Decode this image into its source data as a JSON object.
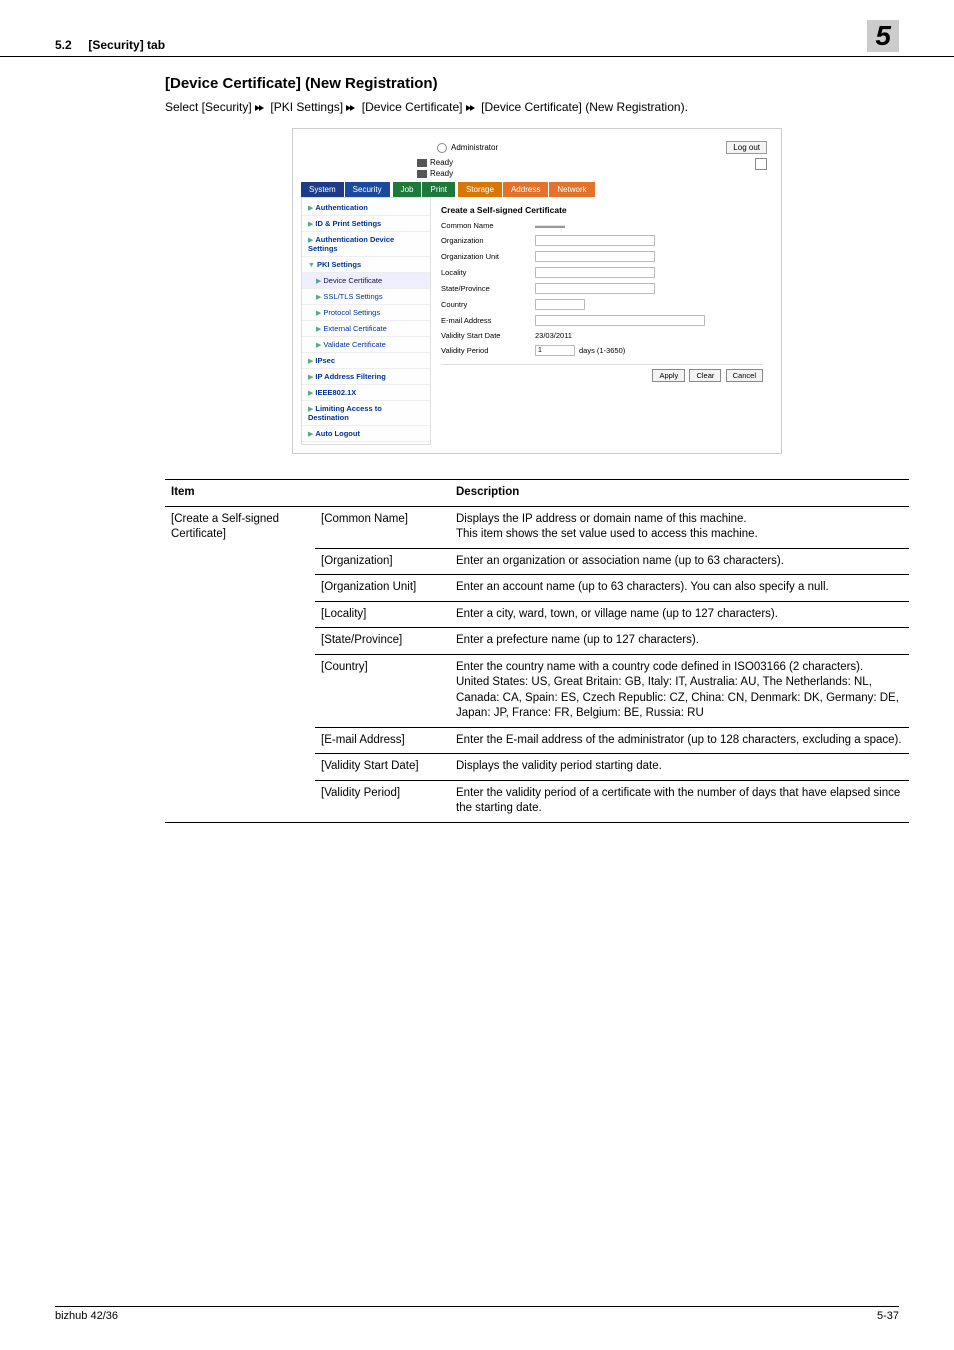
{
  "header": {
    "section": "5.2",
    "tab": "[Security] tab",
    "chapter": "5"
  },
  "page_title": "[Device Certificate] (New Registration)",
  "breadcrumb_parts": [
    "Select [Security]",
    "[PKI Settings]",
    "[Device Certificate]",
    "[Device Certificate] (New Registration)."
  ],
  "screenshot": {
    "admin_label": "Administrator",
    "logout": "Log out",
    "status1": "Ready",
    "status2": "Ready",
    "tabs": [
      "System",
      "Security",
      "Job",
      "Print",
      "Storage",
      "Address",
      "Network"
    ],
    "nav": {
      "authentication": "Authentication",
      "id_print": "ID & Print Settings",
      "auth_device": "Authentication Device Settings",
      "pki": "PKI Settings",
      "device_cert": "Device Certificate",
      "ssl_tls": "SSL/TLS Settings",
      "protocol": "Protocol Settings",
      "ext_cert": "External Certificate",
      "validate_cert": "Validate Certificate",
      "ipsec": "IPsec",
      "ip_filter": "IP Address Filtering",
      "ieee": "IEEE802.1X",
      "limit_access": "Limiting Access to Destination",
      "auto_logout": "Auto Logout"
    },
    "form": {
      "title": "Create a Self-signed Certificate",
      "common_name": "Common Name",
      "organization": "Organization",
      "org_unit": "Organization Unit",
      "locality": "Locality",
      "state": "State/Province",
      "country": "Country",
      "email": "E-mail Address",
      "start_date": "Validity Start Date",
      "start_date_val": "23/03/2011",
      "period": "Validity Period",
      "period_val": "1",
      "period_suffix": "days (1-3650)"
    },
    "buttons": {
      "apply": "Apply",
      "clear": "Clear",
      "cancel": "Cancel"
    }
  },
  "table": {
    "headers": {
      "item": "Item",
      "description": "Description"
    },
    "group": "[Create a Self-signed Certificate]",
    "rows": [
      {
        "sub": "[Common Name]",
        "desc": "Displays the IP address or domain name of this machine.\nThis item shows the set value used to access this machine."
      },
      {
        "sub": "[Organization]",
        "desc": "Enter an organization or association name (up to 63 characters)."
      },
      {
        "sub": "[Organization Unit]",
        "desc": "Enter an account name (up to 63 characters). You can also specify a null."
      },
      {
        "sub": "[Locality]",
        "desc": "Enter a city, ward, town, or village name (up to 127 characters)."
      },
      {
        "sub": "[State/Province]",
        "desc": "Enter a prefecture name (up to 127 characters)."
      },
      {
        "sub": "[Country]",
        "desc": "Enter the country name with a country code defined in ISO03166 (2 characters).\nUnited States: US, Great Britain: GB, Italy: IT, Australia: AU, The Netherlands: NL, Canada: CA, Spain: ES, Czech Republic: CZ, China: CN, Denmark: DK, Germany: DE, Japan: JP, France: FR, Belgium: BE, Russia: RU"
      },
      {
        "sub": "[E-mail Address]",
        "desc": "Enter the E-mail address of the administrator (up to 128 characters, excluding a space)."
      },
      {
        "sub": "[Validity Start Date]",
        "desc": "Displays the validity period starting date."
      },
      {
        "sub": "[Validity Period]",
        "desc": "Enter the validity period of a certificate with the number of days that have elapsed since the starting date."
      }
    ]
  },
  "footer": {
    "left": "bizhub 42/36",
    "right": "5-37"
  }
}
